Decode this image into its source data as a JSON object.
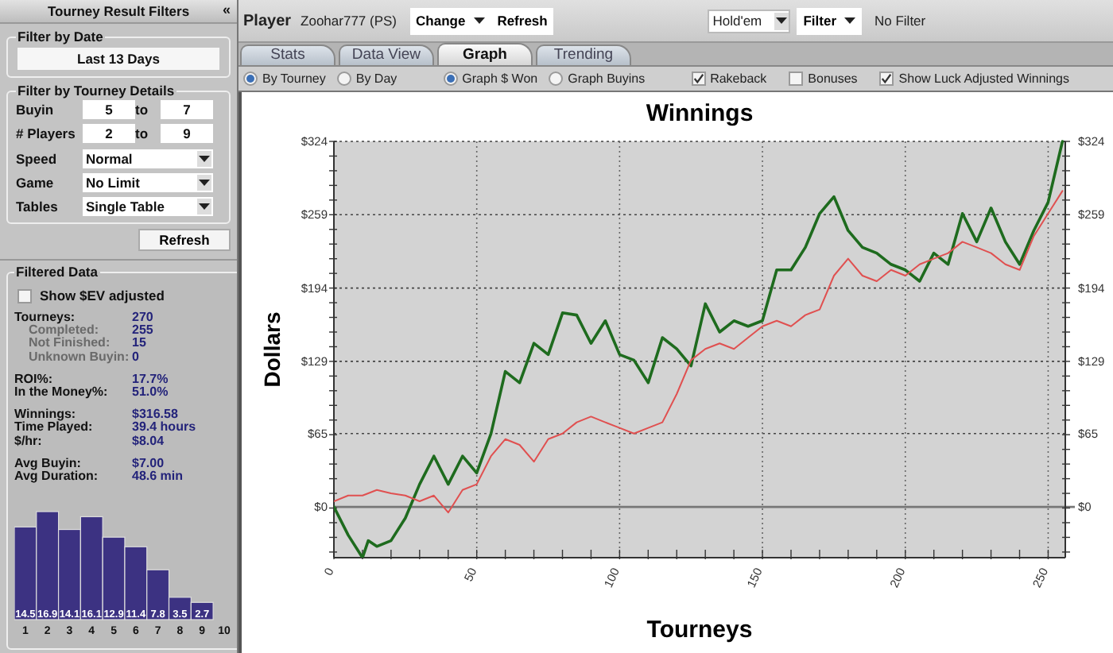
{
  "sidebar": {
    "title": "Tourney Result Filters",
    "collapse": "«",
    "date_group": {
      "legend": "Filter by Date",
      "value": "Last 13 Days"
    },
    "details_group": {
      "legend": "Filter by Tourney Details",
      "ranges": [
        {
          "label": "Buyin",
          "from": "5",
          "separator": "to",
          "to": "7"
        },
        {
          "label": "# Players",
          "from": "2",
          "separator": "to",
          "to": "9"
        }
      ],
      "selects": [
        {
          "label": "Speed",
          "value": "Normal"
        },
        {
          "label": "Game",
          "value": "No Limit"
        },
        {
          "label": "Tables",
          "value": "Single Table"
        }
      ]
    },
    "refresh": "Refresh",
    "filtered": {
      "legend": "Filtered Data",
      "ev_checkbox": {
        "label": "Show $EV adjusted",
        "checked": false
      },
      "stat_groups": [
        [
          {
            "label": "Tourneys:",
            "value": "270",
            "sub": false
          },
          {
            "label": "Completed:",
            "value": "255",
            "sub": true
          },
          {
            "label": "Not Finished:",
            "value": "15",
            "sub": true
          },
          {
            "label": "Unknown Buyin:",
            "value": "0",
            "sub": true
          }
        ],
        [
          {
            "label": "ROI%:",
            "value": "17.7%",
            "sub": false
          },
          {
            "label": "In the Money%:",
            "value": "51.0%",
            "sub": false
          }
        ],
        [
          {
            "label": "Winnings:",
            "value": "$316.58",
            "sub": false
          },
          {
            "label": "Time Played:",
            "value": "39.4 hours",
            "sub": false
          },
          {
            "label": "$/hr:",
            "value": "$8.04",
            "sub": false
          }
        ],
        [
          {
            "label": "Avg Buyin:",
            "value": "$7.00",
            "sub": false
          },
          {
            "label": "Avg Duration:",
            "value": "48.6 min",
            "sub": false
          }
        ]
      ],
      "chart_data": {
        "type": "bar",
        "x": [
          1,
          2,
          3,
          4,
          5,
          6,
          7,
          8,
          9
        ],
        "values": [
          14.5,
          16.9,
          14.1,
          16.1,
          12.9,
          11.4,
          7.8,
          3.5,
          2.7
        ],
        "xticks": [
          1,
          2,
          3,
          4,
          5,
          6,
          7,
          8,
          9,
          10
        ],
        "xlim": [
          0.5,
          10
        ],
        "data_labels": true
      }
    }
  },
  "toolbar": {
    "player_label": "Player",
    "player": "Zoohar777 (PS)",
    "change": "Change",
    "refresh": "Refresh",
    "game": "Hold'em",
    "filter": "Filter",
    "filter_status": "No Filter"
  },
  "tabs": [
    {
      "label": "Stats",
      "selected": false
    },
    {
      "label": "Data View",
      "selected": false
    },
    {
      "label": "Graph",
      "selected": true
    },
    {
      "label": "Trending",
      "selected": false
    }
  ],
  "options": {
    "radio_groups": [
      [
        {
          "label": "By Tourney",
          "selected": true
        },
        {
          "label": "By Day",
          "selected": false
        }
      ],
      [
        {
          "label": "Graph $ Won",
          "selected": true
        },
        {
          "label": "Graph Buyins",
          "selected": false
        }
      ]
    ],
    "checkboxes": [
      {
        "label": "Rakeback",
        "checked": true
      },
      {
        "label": "Bonuses",
        "checked": false
      },
      {
        "label": "Show Luck Adjusted Winnings",
        "checked": true
      }
    ]
  },
  "chart_data": {
    "type": "line",
    "title": "Winnings",
    "xlabel": "Tourneys",
    "ylabel": "Dollars",
    "grid": true,
    "x": [
      0,
      5,
      10,
      12,
      15,
      20,
      25,
      30,
      35,
      40,
      45,
      50,
      55,
      60,
      65,
      70,
      75,
      80,
      85,
      90,
      95,
      100,
      105,
      110,
      115,
      120,
      125,
      130,
      135,
      140,
      145,
      150,
      155,
      160,
      165,
      170,
      175,
      180,
      185,
      190,
      195,
      200,
      205,
      210,
      215,
      220,
      225,
      230,
      235,
      240,
      245,
      250,
      255
    ],
    "series": [
      {
        "color": "#1e6b1e",
        "values": [
          0,
          -25,
          -45,
          -30,
          -35,
          -30,
          -10,
          20,
          45,
          20,
          45,
          30,
          65,
          120,
          110,
          145,
          135,
          172,
          170,
          145,
          165,
          135,
          130,
          110,
          150,
          140,
          125,
          180,
          155,
          165,
          160,
          165,
          210,
          210,
          230,
          260,
          275,
          245,
          230,
          225,
          215,
          210,
          200,
          225,
          215,
          260,
          235,
          265,
          235,
          215,
          245,
          270,
          324
        ]
      },
      {
        "color": "#e05050",
        "values": [
          5,
          10,
          10,
          12,
          15,
          12,
          10,
          5,
          10,
          -5,
          15,
          20,
          45,
          60,
          55,
          40,
          60,
          65,
          75,
          80,
          75,
          70,
          65,
          70,
          75,
          100,
          130,
          140,
          145,
          140,
          150,
          160,
          165,
          160,
          170,
          175,
          205,
          220,
          205,
          200,
          210,
          205,
          215,
          220,
          225,
          235,
          230,
          225,
          215,
          210,
          240,
          260,
          280
        ]
      }
    ],
    "xlim": [
      0,
      256
    ],
    "ylim": [
      -45,
      324
    ],
    "xticks": [
      0,
      50,
      100,
      150,
      200,
      250
    ],
    "yticks": [
      {
        "value": 0,
        "label": "$0"
      },
      {
        "value": 65,
        "label": "$65"
      },
      {
        "value": 129,
        "label": "$129"
      },
      {
        "value": 194,
        "label": "$194"
      },
      {
        "value": 259,
        "label": "$259"
      },
      {
        "value": 324,
        "label": "$324"
      }
    ]
  }
}
